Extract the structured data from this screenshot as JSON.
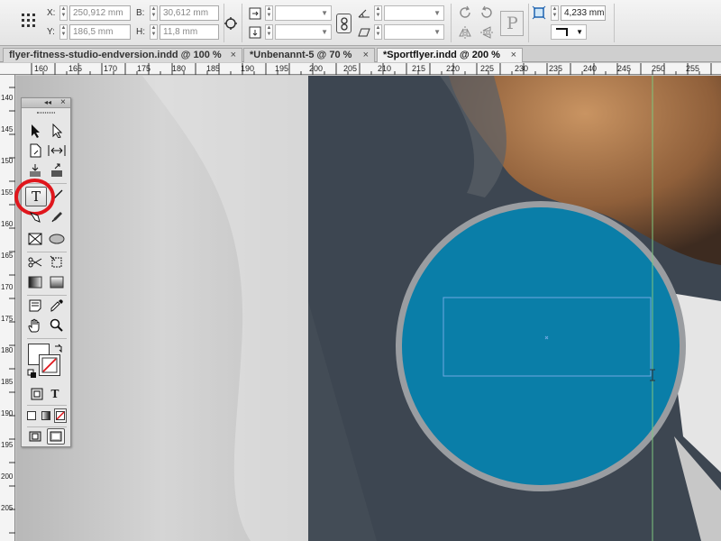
{
  "control_bar": {
    "x_label": "X:",
    "x_value": "250,912 mm",
    "y_label": "Y:",
    "y_value": "186,5 mm",
    "w_label": "B:",
    "w_value": "30,612 mm",
    "h_label": "H:",
    "h_value": "11,8 mm",
    "stroke_weight": "4,233 mm",
    "paragraph_glyph": "P"
  },
  "tabs": [
    {
      "label": "flyer-fitness-studio-endversion.indd @ 100 %",
      "close": "×"
    },
    {
      "label": "*Unbenannt-5 @ 70 %",
      "close": "×"
    },
    {
      "label": "*Sportflyer.indd @ 200 %",
      "close": "×"
    }
  ],
  "ruler_top": [
    "160",
    "165",
    "170",
    "175",
    "180",
    "185",
    "190",
    "195",
    "200",
    "205",
    "210",
    "215",
    "220",
    "225",
    "230",
    "235",
    "240",
    "245",
    "250",
    "255"
  ],
  "ruler_left": [
    "140",
    "145",
    "150",
    "155",
    "160",
    "165",
    "170",
    "175",
    "180",
    "185",
    "190",
    "195",
    "200",
    "205"
  ],
  "tools_panel": {
    "collapse_glyph": "◂◂",
    "close_glyph": "×",
    "type_tool": "T",
    "format_text_glyph": "T"
  },
  "colors": {
    "accent_circle": "#0a7ea8",
    "highlight_ring": "#e0161c",
    "dark_panel": "#3d4651",
    "guide": "#7ec77e"
  }
}
